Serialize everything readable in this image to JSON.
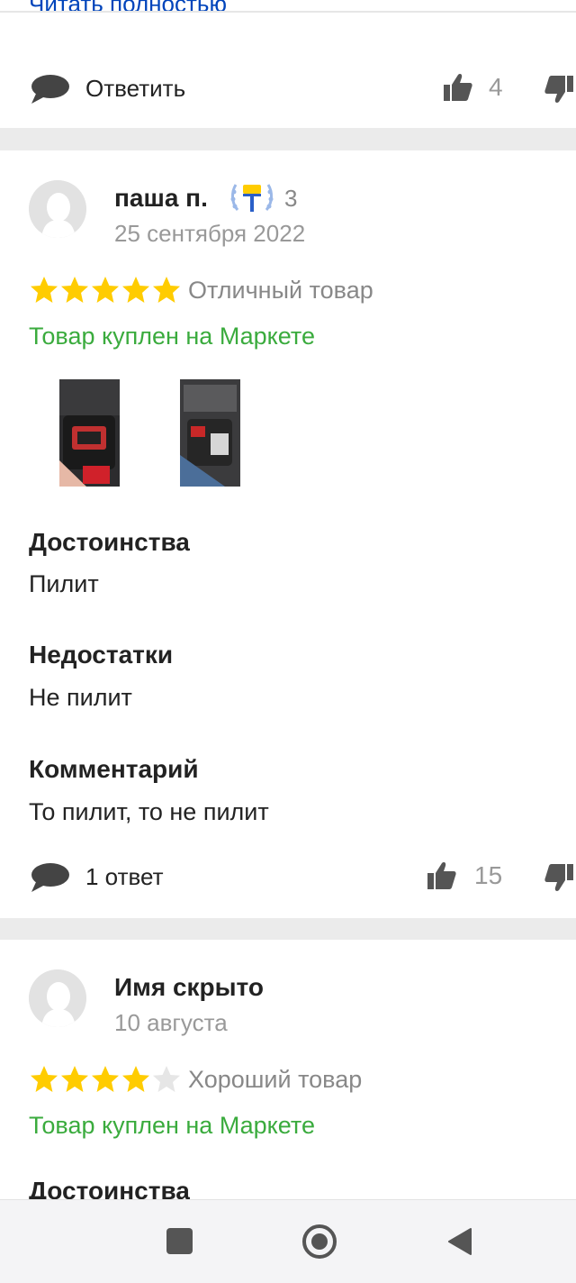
{
  "review_prev": {
    "read_more": "Читать полностью",
    "reply_label": "Ответить",
    "likes": "4"
  },
  "review_main": {
    "author": "паша п.",
    "badge_count": "3",
    "date": "25 сентября 2022",
    "rating": 5,
    "rating_label": "Отличный товар",
    "bought_label": "Товар куплен на Маркете",
    "photos": [
      "photo-1",
      "photo-2"
    ],
    "pros_title": "Достоинства",
    "pros_text": "Пилит",
    "cons_title": "Недостатки",
    "cons_text": "Не пилит",
    "comment_title": "Комментарий",
    "comment_text": "То пилит, то не пилит",
    "replies_label": "1 ответ",
    "likes": "15"
  },
  "review_next": {
    "author": "Имя скрыто",
    "date": "10 августа",
    "rating": 4,
    "rating_label": "Хороший товар",
    "bought_label": "Товар куплен на Маркете",
    "pros_title": "Достоинства"
  },
  "colors": {
    "star_filled": "#ffcc00",
    "star_empty": "#e6e6e6",
    "bought_green": "#3aab3d",
    "link_blue": "#0044bb"
  },
  "navbar": {
    "icons": [
      "square-icon",
      "circle-home-icon",
      "back-triangle-icon"
    ]
  }
}
